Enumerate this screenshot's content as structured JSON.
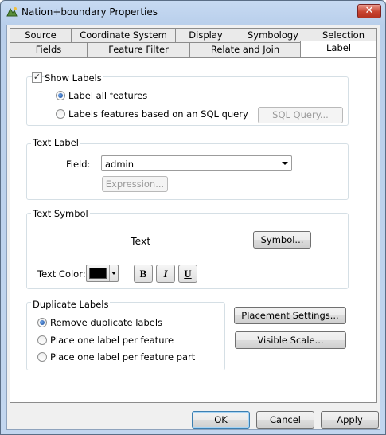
{
  "window": {
    "title": "Nation+boundary  Properties",
    "close": "✕"
  },
  "tabs": {
    "row1": [
      "Source",
      "Coordinate System",
      "Display",
      "Symbology",
      "Selection"
    ],
    "row2": [
      "Fields",
      "Feature Filter",
      "Relate and Join",
      "Label"
    ],
    "active": "Label"
  },
  "show_labels": {
    "checkbox_label": "Show Labels",
    "checked": true,
    "radio_all": "Label all features",
    "radio_sql": "Labels features based on an SQL query",
    "sql_button": "SQL Query..."
  },
  "text_label": {
    "group_title": "Text Label",
    "field_label": "Field:",
    "field_value": "admin",
    "expression_button": "Expression..."
  },
  "text_symbol": {
    "group_title": "Text Symbol",
    "preview_text": "Text",
    "symbol_button": "Symbol...",
    "color_label": "Text Color:",
    "color_value": "#000000",
    "bold": "B",
    "italic": "I",
    "underline": "U"
  },
  "duplicate_labels": {
    "group_title": "Duplicate Labels",
    "options": [
      "Remove duplicate labels",
      "Place one label per feature",
      "Place one label per feature part"
    ],
    "selected": 0
  },
  "side_buttons": {
    "placement": "Placement Settings...",
    "visible_scale": "Visible Scale..."
  },
  "footer": {
    "ok": "OK",
    "cancel": "Cancel",
    "apply": "Apply"
  }
}
